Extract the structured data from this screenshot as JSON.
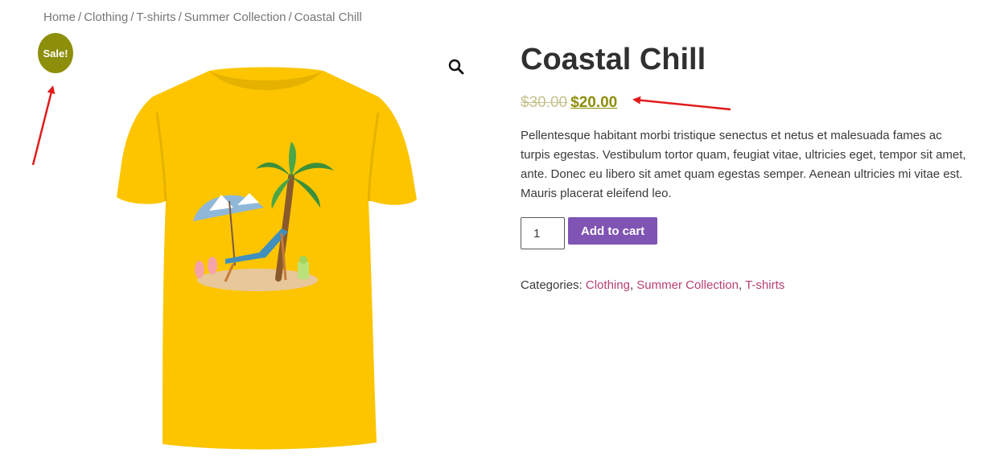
{
  "breadcrumb": {
    "items": [
      "Home",
      "Clothing",
      "T-shirts",
      "Summer Collection",
      "Coastal Chill"
    ],
    "separator": "/"
  },
  "badge": {
    "label": "Sale!",
    "color": "#8d8e0a"
  },
  "icons": {
    "zoom": "magnifier-icon"
  },
  "product": {
    "title": "Coastal Chill",
    "regular_price": "$30.00",
    "sale_price": "$20.00",
    "description": "Pellentesque habitant morbi tristique senectus et netus et malesuada fames ac turpis egestas. Vestibulum tortor quam, feugiat vitae, ultricies eget, tempor sit amet, ante. Donec eu libero sit amet quam egestas semper. Aenean ultricies mi vitae est. Mauris placerat eleifend leo.",
    "quantity": "1",
    "add_to_cart_label": "Add to cart",
    "categories_label": "Categories:",
    "categories": [
      "Clothing",
      "Summer Collection",
      "T-shirts"
    ]
  },
  "colors": {
    "accent": "#8d8e0a",
    "button": "#7f54b3",
    "link": "#b83f6f",
    "annotation_arrow": "#e11b1b"
  }
}
